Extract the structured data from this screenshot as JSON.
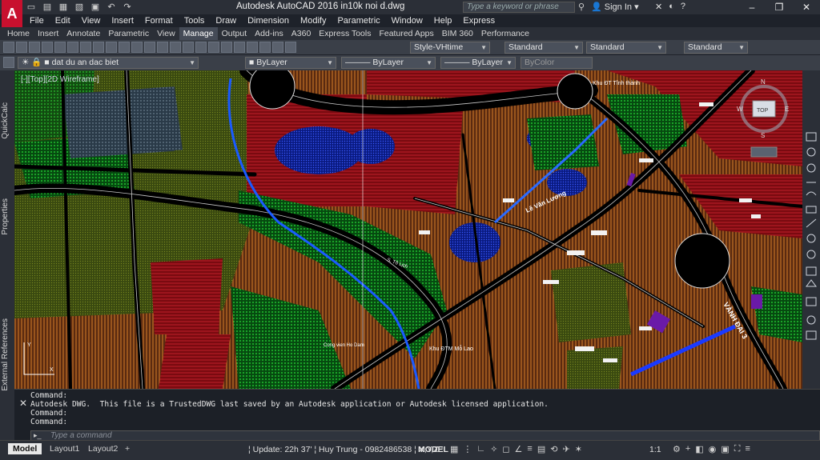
{
  "app": {
    "logo": "A",
    "title": "Autodesk AutoCAD 2016    in10k noi d.dwg",
    "search_placeholder": "Type a keyword or phrase",
    "user": "Sign In",
    "help": "?"
  },
  "menu": [
    "File",
    "Edit",
    "View",
    "Insert",
    "Format",
    "Tools",
    "Draw",
    "Dimension",
    "Modify",
    "Parametric",
    "Window",
    "Help",
    "Express"
  ],
  "ribbon_tabs": [
    "Home",
    "Insert",
    "Annotate",
    "Parametric",
    "View",
    "Manage",
    "Output",
    "Add-ins",
    "A360",
    "Express Tools",
    "Featured Apps",
    "BIM 360",
    "Performance"
  ],
  "ribbon_active": "Manage",
  "toolbar": {
    "text_style": "Style-VHtime",
    "dim_style": "Standard",
    "table_style": "Standard",
    "mleader_style": "Standard",
    "layer": "dat du an dac biet",
    "color": "ByLayer",
    "linetype": "ByLayer",
    "lineweight": "ByLayer",
    "plotstyle": "ByColor"
  },
  "side_palettes": [
    "QuickCalc",
    "Properties",
    "External References"
  ],
  "viewport_label": "[-][Top][2D Wireframe]",
  "map_labels": [
    "Khu ĐT Tĩnh thành",
    "Lê Văn Lương",
    "VÀNH ĐAI 3",
    "Khu ĐTM Mỗ Lao",
    "Cong vien Ho Dam",
    "S. Tô Lịch"
  ],
  "viewcube": {
    "top": "TOP",
    "n": "N",
    "w": "W",
    "e": "E",
    "s": "S"
  },
  "command_lines": [
    "Command:",
    "Autodesk DWG.  This file is a TrustedDWG last saved by an Autodesk application or Autodesk licensed application.",
    "Command:",
    "Command:"
  ],
  "command_placeholder": "Type a command",
  "layout_tabs": [
    "Model",
    "Layout1",
    "Layout2"
  ],
  "status": {
    "update": "¦ Update: 22h 37' ¦ Huy Trung - 0982486538 ¦ X,Y,Z :",
    "model": "MODEL",
    "scale": "1:1"
  }
}
